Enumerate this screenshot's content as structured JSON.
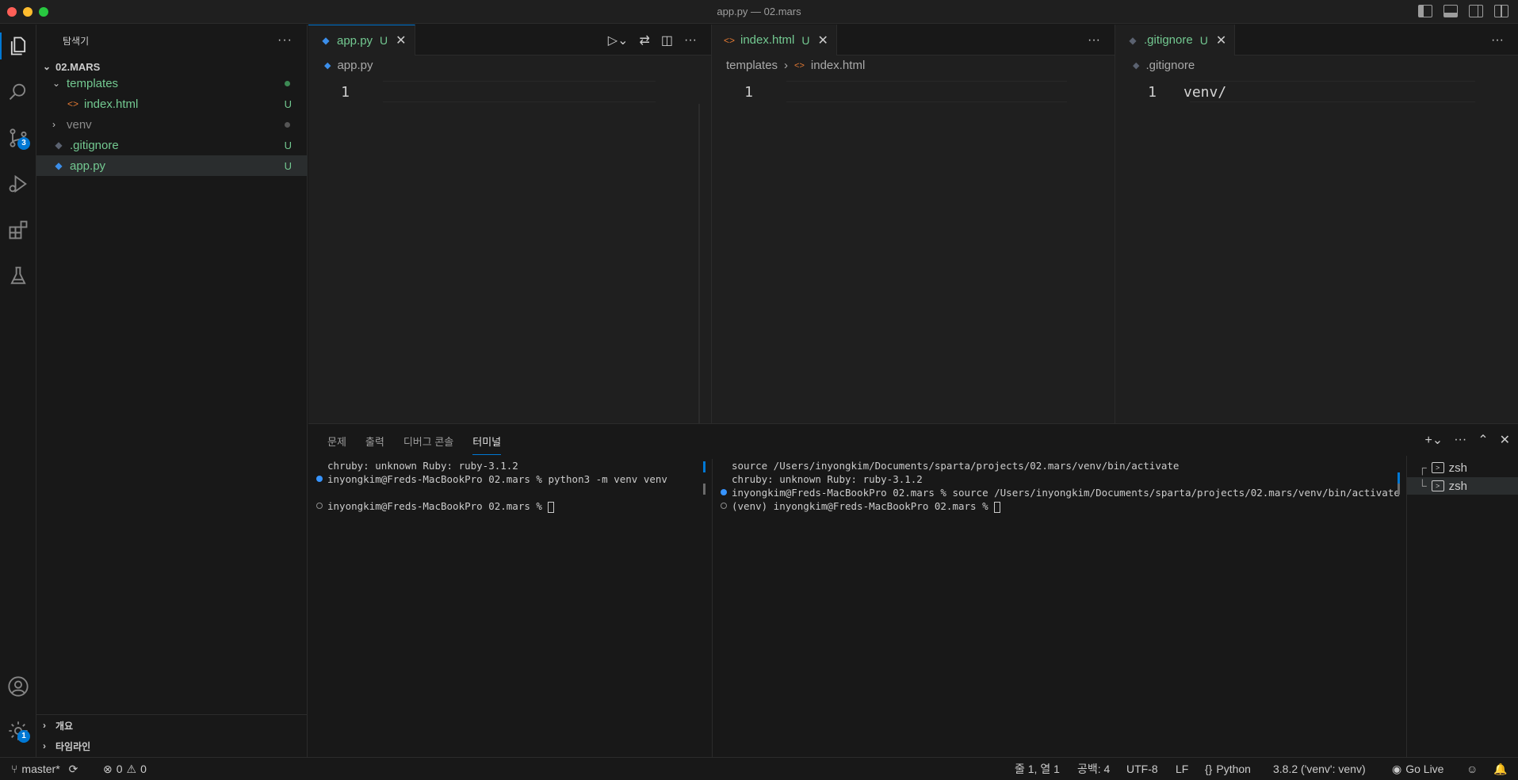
{
  "window": {
    "title": "app.py — 02.mars"
  },
  "activity_bar": {
    "items": [
      {
        "name": "explorer-icon",
        "active": true
      },
      {
        "name": "search-icon"
      },
      {
        "name": "source-control-icon",
        "badge": "3"
      },
      {
        "name": "run-debug-icon"
      },
      {
        "name": "extensions-icon"
      },
      {
        "name": "testing-icon"
      }
    ],
    "bottom": [
      {
        "name": "account-icon"
      },
      {
        "name": "manage-gear-icon",
        "badge": "1"
      }
    ]
  },
  "sidebar": {
    "title": "탐색기",
    "more": "···",
    "root": "02.MARS",
    "tree": [
      {
        "label": "templates",
        "type": "folder",
        "expanded": true,
        "status": "dot-green"
      },
      {
        "label": "index.html",
        "type": "html",
        "status": "U"
      },
      {
        "label": "venv",
        "type": "folder",
        "expanded": false,
        "status": "dot-grey"
      },
      {
        "label": ".gitignore",
        "type": "git",
        "status": "U"
      },
      {
        "label": "app.py",
        "type": "python",
        "status": "U",
        "selected": true
      }
    ],
    "outline": "개요",
    "timeline": "타임라인"
  },
  "editors": [
    {
      "tab": {
        "label": "app.py",
        "status": "U",
        "close": "✕",
        "active": true
      },
      "breadcrumb": [
        "app.py"
      ],
      "lines": [
        {
          "num": "1",
          "text": ""
        }
      ]
    },
    {
      "tab": {
        "label": "index.html",
        "status": "U",
        "close": "✕"
      },
      "breadcrumb": [
        "templates",
        "index.html"
      ],
      "lines": [
        {
          "num": "1",
          "text": ""
        }
      ]
    },
    {
      "tab": {
        "label": ".gitignore",
        "status": "U",
        "close": "✕"
      },
      "breadcrumb": [
        ".gitignore"
      ],
      "lines": [
        {
          "num": "1",
          "text": "venv/"
        }
      ]
    }
  ],
  "panel": {
    "tabs": [
      "문제",
      "출력",
      "디버그 콘솔",
      "터미널"
    ],
    "active_tab": "터미널",
    "terminal_left": [
      "chruby: unknown Ruby: ruby-3.1.2",
      "inyongkim@Freds-MacBookPro 02.mars % python3 -m venv venv",
      "",
      "inyongkim@Freds-MacBookPro 02.mars % "
    ],
    "terminal_right": [
      "source /Users/inyongkim/Documents/sparta/projects/02.mars/venv/bin/activate",
      "chruby: unknown Ruby: ruby-3.1.2",
      "inyongkim@Freds-MacBookPro 02.mars % source /Users/inyongkim/Documents/sparta/projects/02.mars/venv/bin/activate",
      "(venv) inyongkim@Freds-MacBookPro 02.mars % "
    ],
    "terminals": [
      "zsh",
      "zsh"
    ]
  },
  "status_bar": {
    "branch": "master*",
    "errors": "0",
    "warnings": "0",
    "position": "줄 1, 열 1",
    "spaces": "공백: 4",
    "encoding": "UTF-8",
    "eol": "LF",
    "language": "Python",
    "interpreter": "3.8.2 ('venv': venv)",
    "go_live": "Go Live"
  },
  "colors": {
    "accent": "#0078d4",
    "git_untracked": "#73c991",
    "background": "#1f1f1f"
  }
}
